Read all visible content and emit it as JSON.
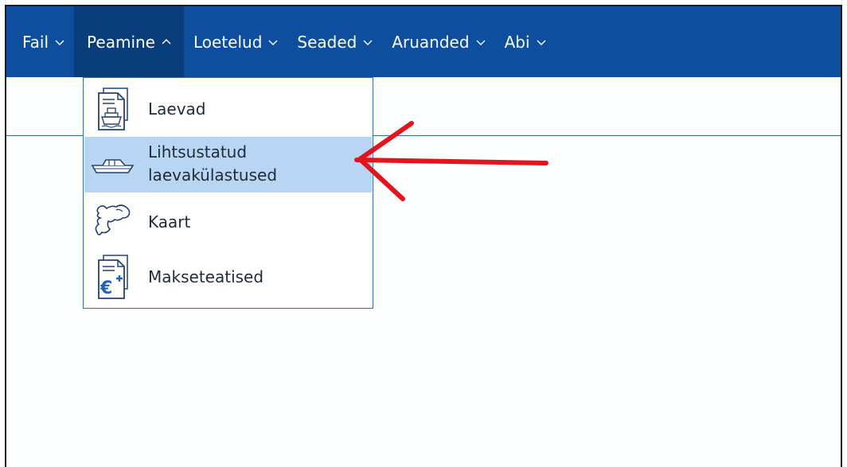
{
  "menubar": {
    "items": [
      {
        "label": "Fail",
        "state": "collapsed"
      },
      {
        "label": "Peamine",
        "state": "expanded"
      },
      {
        "label": "Loetelud",
        "state": "collapsed"
      },
      {
        "label": "Seaded",
        "state": "collapsed"
      },
      {
        "label": "Aruanded",
        "state": "collapsed"
      },
      {
        "label": "Abi",
        "state": "collapsed"
      }
    ]
  },
  "dropdown": {
    "items": [
      {
        "label": "Laevad",
        "icon": "ship-document-icon"
      },
      {
        "label_line1": "Lihtsustatud",
        "label_line2": "laevakülastused",
        "icon": "boat-icon",
        "highlighted": true
      },
      {
        "label": "Kaart",
        "icon": "map-icon"
      },
      {
        "label": "Makseteatised",
        "icon": "euro-document-icon"
      }
    ]
  },
  "annotation": {
    "color": "#e3141c",
    "shape": "arrow-pointing-left"
  },
  "colors": {
    "menubar": "#0d4f9e",
    "menubar_active": "#0a3d7b",
    "highlight": "#b8d6f4"
  }
}
